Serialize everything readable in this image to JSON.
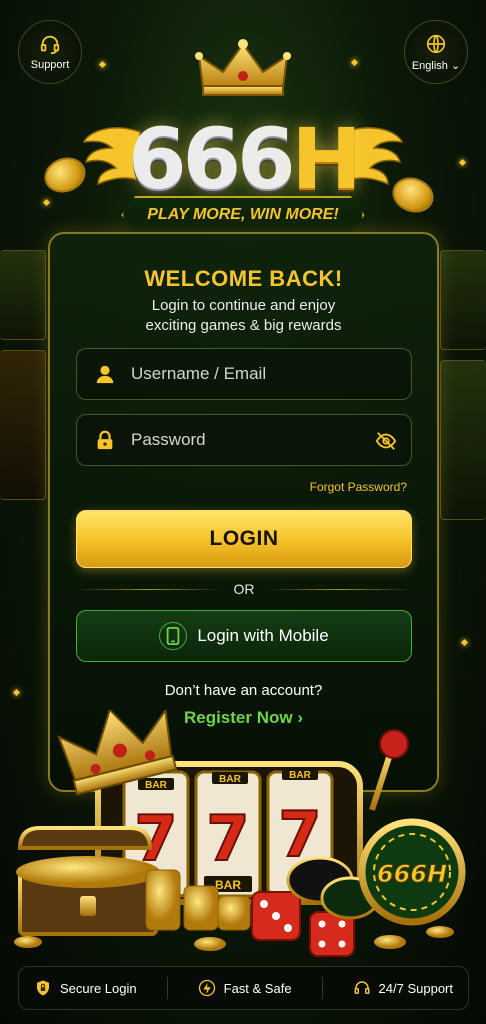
{
  "header": {
    "support_label": "Support",
    "language_label": "English"
  },
  "brand": {
    "logo_main": "666",
    "logo_accent": "H",
    "tagline": "PLAY MORE, WIN MORE!",
    "badge_text": "666H"
  },
  "login": {
    "title": "WELCOME BACK!",
    "subtitle_line1": "Login to continue and enjoy",
    "subtitle_line2": "exciting games & big rewards",
    "username_placeholder": "Username / Email",
    "password_placeholder": "Password",
    "forgot_label": "Forgot Password?",
    "login_label": "LOGIN",
    "or_label": "OR",
    "mobile_label": "Login with Mobile",
    "no_account_text": "Don’t have an account?",
    "register_label": "Register Now"
  },
  "slot": {
    "reel_symbol": "7",
    "bar_label": "BAR"
  },
  "footer": {
    "items": [
      {
        "label": "Secure Login",
        "icon": "shield-lock-icon"
      },
      {
        "label": "Fast & Safe",
        "icon": "lightning-icon"
      },
      {
        "label": "24/7 Support",
        "icon": "headset-icon"
      }
    ]
  },
  "colors": {
    "gold": "#f6c42b",
    "green_accent": "#6ed44a",
    "card_border": "#8a7a20",
    "background": "#0c1a08"
  }
}
